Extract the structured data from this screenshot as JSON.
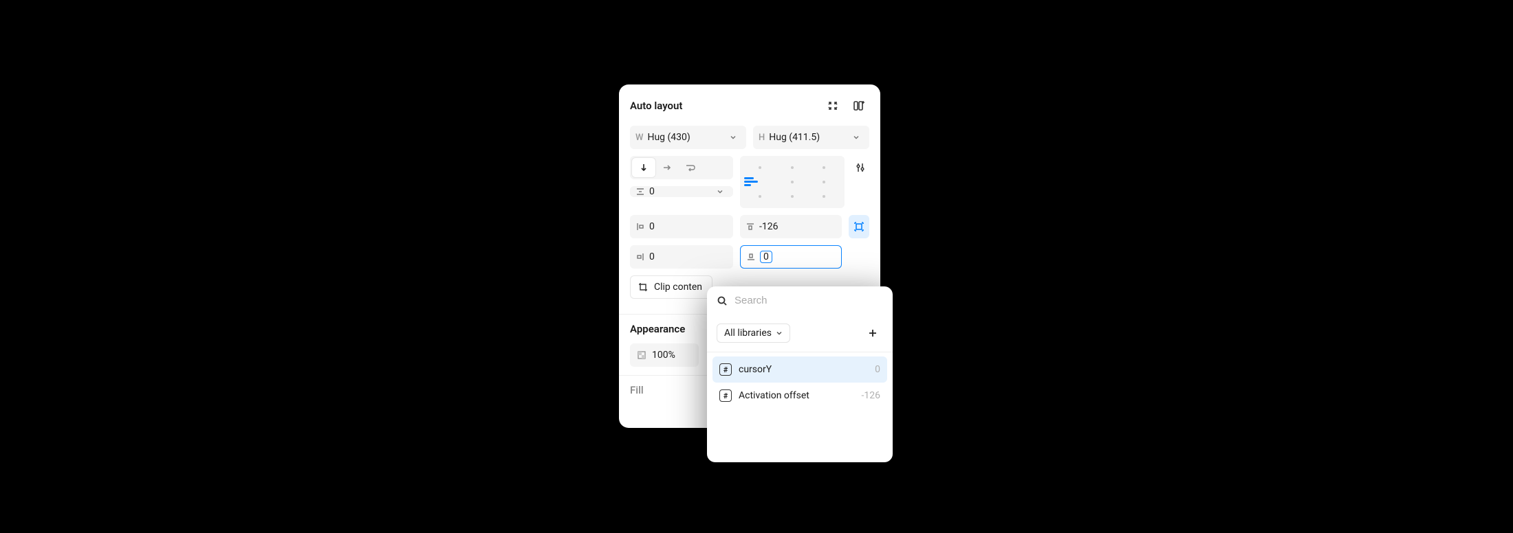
{
  "autoLayout": {
    "title": "Auto layout",
    "width": {
      "prefix": "W",
      "value": "Hug (430)"
    },
    "height": {
      "prefix": "H",
      "value": "Hug (411.5)"
    },
    "gap": {
      "value": "0"
    },
    "paddingLeft": "0",
    "paddingTop": "-126",
    "paddingRight": "0",
    "paddingBottom": "0",
    "clipContent": "Clip conten"
  },
  "appearance": {
    "title": "Appearance",
    "opacity": "100%"
  },
  "fill": {
    "title": "Fill"
  },
  "popover": {
    "searchPlaceholder": "Search",
    "librarySelect": "All libraries",
    "vars": [
      {
        "name": "cursorY",
        "value": "0"
      },
      {
        "name": "Activation offset",
        "value": "-126"
      }
    ]
  }
}
